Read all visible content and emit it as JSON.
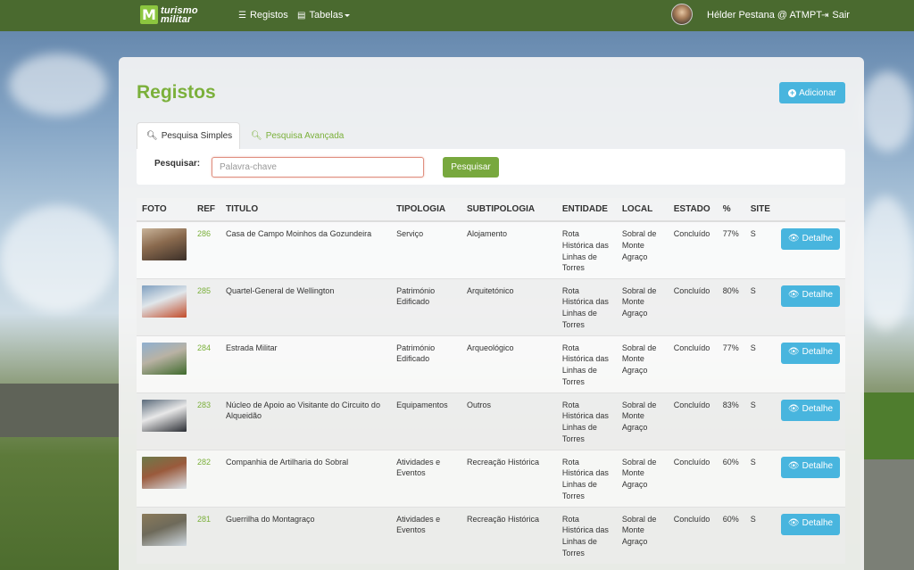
{
  "nav": {
    "brand_line1": "turismo",
    "brand_line2": "militar",
    "registos": "Registos",
    "tabelas": "Tabelas",
    "user": "Hélder Pestana @ ATMPT",
    "logout": "Sair"
  },
  "page": {
    "title": "Registos",
    "add_button": "Adicionar"
  },
  "tabs": {
    "simple": "Pesquisa Simples",
    "advanced": "Pesquisa Avançada"
  },
  "search": {
    "label": "Pesquisar:",
    "value": "",
    "placeholder": "Palavra-chave",
    "button": "Pesquisar"
  },
  "table": {
    "headers": [
      "FOTO",
      "REF",
      "TITULO",
      "TIPOLOGIA",
      "SUBTIPOLOGIA",
      "ENTIDADE",
      "LOCAL",
      "ESTADO",
      "%",
      "SITE"
    ],
    "detail_label": "Detalhe",
    "rows": [
      {
        "ref": "286",
        "titulo": "Casa de Campo Moinhos da Gozundeira",
        "tipologia": "Serviço",
        "subtipologia": "Alojamento",
        "entidade": "Rota Histórica das Linhas de Torres",
        "local": "Sobral de Monte Agraço",
        "estado": "Concluído",
        "pct": "77%",
        "site": "S",
        "thumb": [
          "#3b2f28",
          "#8a6a4e",
          "#c9b49a"
        ]
      },
      {
        "ref": "285",
        "titulo": "Quartel-General de Wellington",
        "tipologia": "Património Edificado",
        "subtipologia": "Arquitetónico",
        "entidade": "Rota Histórica das Linhas de Torres",
        "local": "Sobral de Monte Agraço",
        "estado": "Concluído",
        "pct": "80%",
        "site": "S",
        "thumb": [
          "#c24b2a",
          "#e0e6ea",
          "#7fa0c0"
        ]
      },
      {
        "ref": "284",
        "titulo": "Estrada Militar",
        "tipologia": "Património Edificado",
        "subtipologia": "Arqueológico",
        "entidade": "Rota Histórica das Linhas de Torres",
        "local": "Sobral de Monte Agraço",
        "estado": "Concluído",
        "pct": "77%",
        "site": "S",
        "thumb": [
          "#3f6b2c",
          "#b9b2a4",
          "#8fb0d0"
        ]
      },
      {
        "ref": "283",
        "titulo": "Núcleo de Apoio ao Visitante do Circuito do Alqueidão",
        "tipologia": "Equipamentos",
        "subtipologia": "Outros",
        "entidade": "Rota Histórica das Linhas de Torres",
        "local": "Sobral de Monte Agraço",
        "estado": "Concluído",
        "pct": "83%",
        "site": "S",
        "thumb": [
          "#2a2d33",
          "#e8e8e8",
          "#5a6a7a"
        ]
      },
      {
        "ref": "282",
        "titulo": "Companhia de Artilharia do Sobral",
        "tipologia": "Atividades e Eventos",
        "subtipologia": "Recreação Histórica",
        "entidade": "Rota Histórica das Linhas de Torres",
        "local": "Sobral de Monte Agraço",
        "estado": "Concluído",
        "pct": "60%",
        "site": "S",
        "thumb": [
          "#d9e0e6",
          "#9a5a3c",
          "#6c7a4a"
        ]
      },
      {
        "ref": "281",
        "titulo": "Guerrilha do Montagraço",
        "tipologia": "Atividades e Eventos",
        "subtipologia": "Recreação Histórica",
        "entidade": "Rota Histórica das Linhas de Torres",
        "local": "Sobral de Monte Agraço",
        "estado": "Concluído",
        "pct": "60%",
        "site": "S",
        "thumb": [
          "#cfd8e0",
          "#6e6a5a",
          "#8a7a5a"
        ]
      }
    ]
  }
}
